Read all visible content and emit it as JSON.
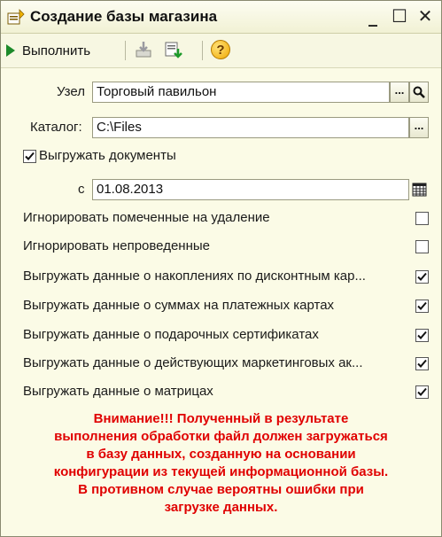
{
  "window": {
    "title": "Создание базы магазина",
    "minimize_glyph": "_",
    "maximize_glyph": "☐",
    "close_glyph": "✕"
  },
  "toolbar": {
    "run_label": "Выполнить",
    "help_glyph": "?",
    "icons": [
      "run-icon",
      "load-icon",
      "unload-icon",
      "help-icon"
    ]
  },
  "form": {
    "node_label": "Узел",
    "node_value": "Торговый павильон",
    "catalog_label": "Каталог:",
    "catalog_value": "C:\\Files",
    "ellipsis": "...",
    "export_docs_label": "Выгружать документы",
    "export_docs_checked": true,
    "from_label": "с",
    "from_date": "01.08.2013",
    "options": [
      {
        "label": "Игнорировать помеченные на удаление",
        "checked": false
      },
      {
        "label": "Игнорировать непроведенные",
        "checked": false
      },
      {
        "label": "Выгружать данные о накоплениях по дисконтным кар...",
        "checked": true
      },
      {
        "label": "Выгружать данные о суммах на платежных картах",
        "checked": true
      },
      {
        "label": "Выгружать данные о подарочных сертификатах",
        "checked": true
      },
      {
        "label": "Выгружать данные о действующих маркетинговых ак...",
        "checked": true
      },
      {
        "label": "Выгружать данные о матрицах",
        "checked": true
      }
    ]
  },
  "warning": {
    "lines": [
      "Внимание!!! Полученный в результате",
      "выполнения обработки файл должен загружаться",
      "в базу данных, созданную на основании",
      "конфигурации из текущей информационной базы.",
      "В противном случае вероятны ошибки при",
      "загрузке данных."
    ]
  },
  "colors": {
    "background": "#fbfbe6",
    "warning_text": "#e00000",
    "run_arrow": "#1c8a2a"
  }
}
